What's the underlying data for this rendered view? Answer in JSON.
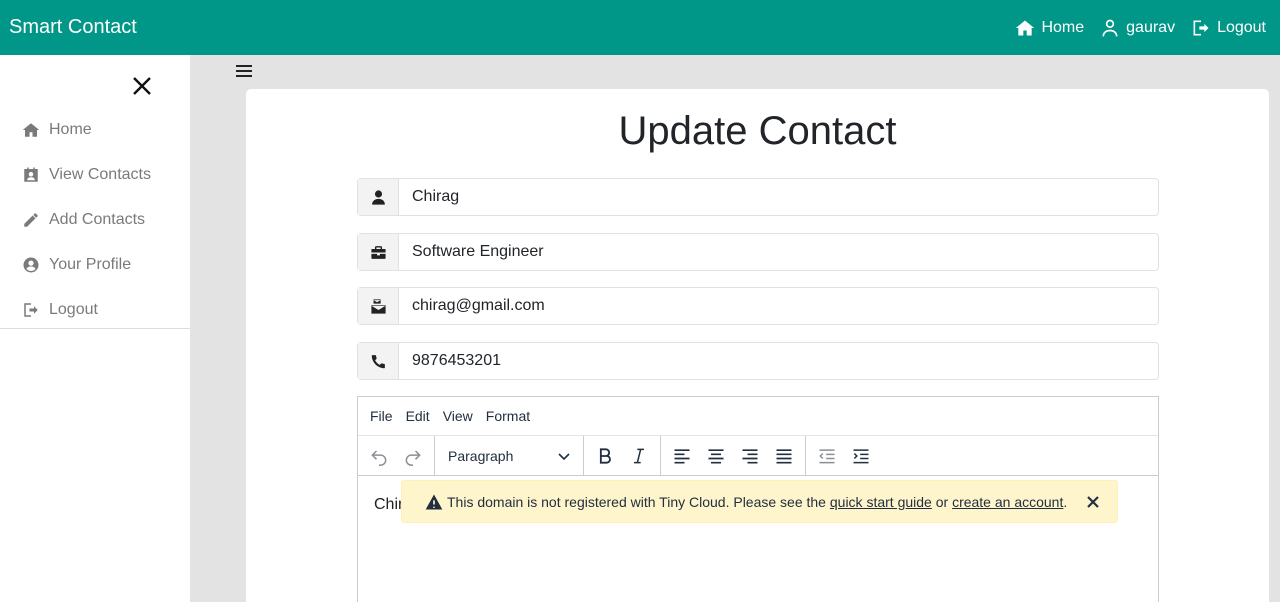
{
  "navbar": {
    "brand": "Smart Contact",
    "links": [
      {
        "label": "Home",
        "icon": "home-icon"
      },
      {
        "label": "gaurav",
        "icon": "user-icon"
      },
      {
        "label": "Logout",
        "icon": "logout-icon"
      }
    ]
  },
  "sidebar": {
    "items": [
      {
        "label": "Home",
        "icon": "home-icon"
      },
      {
        "label": "View Contacts",
        "icon": "address-card-icon"
      },
      {
        "label": "Add Contacts",
        "icon": "pencil-icon"
      },
      {
        "label": "Your Profile",
        "icon": "user-circle-icon"
      },
      {
        "label": "Logout",
        "icon": "logout-icon"
      }
    ]
  },
  "page": {
    "title": "Update Contact"
  },
  "form": {
    "name": "Chirag",
    "work": "Software Engineer",
    "email": "chirag@gmail.com",
    "phone": "9876453201"
  },
  "editor": {
    "menu": [
      "File",
      "Edit",
      "View",
      "Format"
    ],
    "block_format": "Paragraph",
    "content": "Chir",
    "notice": {
      "text_before": "This domain is not registered with Tiny Cloud. Please see the",
      "link1": "quick start guide",
      "text_mid": "or",
      "link2": "create an account",
      "text_after": "."
    }
  },
  "colors": {
    "primary": "#009688",
    "notice_bg": "#fff5cc"
  }
}
